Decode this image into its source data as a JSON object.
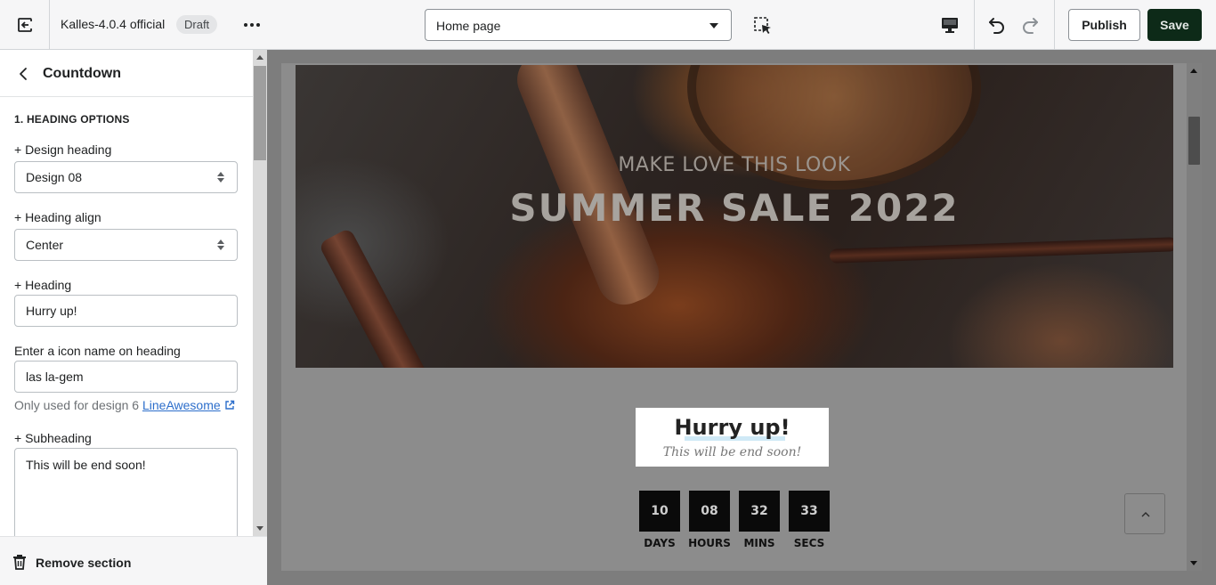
{
  "topbar": {
    "theme_name": "Kalles-4.0.4 official",
    "status_badge": "Draft",
    "page_select": "Home page",
    "publish_label": "Publish",
    "save_label": "Save"
  },
  "sidebar": {
    "title": "Countdown",
    "section_heading": "1. HEADING OPTIONS",
    "fields": {
      "design_heading": {
        "label": "+ Design heading",
        "value": "Design 08"
      },
      "heading_align": {
        "label": "+ Heading align",
        "value": "Center"
      },
      "heading": {
        "label": "+ Heading",
        "value": "Hurry up!"
      },
      "icon_name": {
        "label": "Enter a icon name on heading",
        "value": "las la-gem"
      },
      "subheading": {
        "label": "+ Subheading",
        "value": "This will be end soon!"
      }
    },
    "help_text": "Only used for design 6",
    "help_link": "LineAwesome",
    "remove_label": "Remove section"
  },
  "preview": {
    "hero_subtitle": "MAKE LOVE THIS LOOK",
    "hero_title": "SUMMER SALE 2022",
    "heading": "Hurry up!",
    "subheading": "This will be end soon!",
    "countdown": [
      {
        "value": "10",
        "label": "DAYS"
      },
      {
        "value": "08",
        "label": "HOURS"
      },
      {
        "value": "32",
        "label": "MINS"
      },
      {
        "value": "33",
        "label": "SECS"
      }
    ]
  },
  "colors": {
    "save_bg": "#0d2a18",
    "link": "#2c6ecb",
    "heading_highlight": "#cfe9f6"
  },
  "icons": [
    "exit-icon",
    "more-icon",
    "select-element-icon",
    "desktop-icon",
    "undo-icon",
    "redo-icon",
    "back-icon",
    "external-link-icon",
    "trash-icon",
    "arrow-up-icon"
  ]
}
